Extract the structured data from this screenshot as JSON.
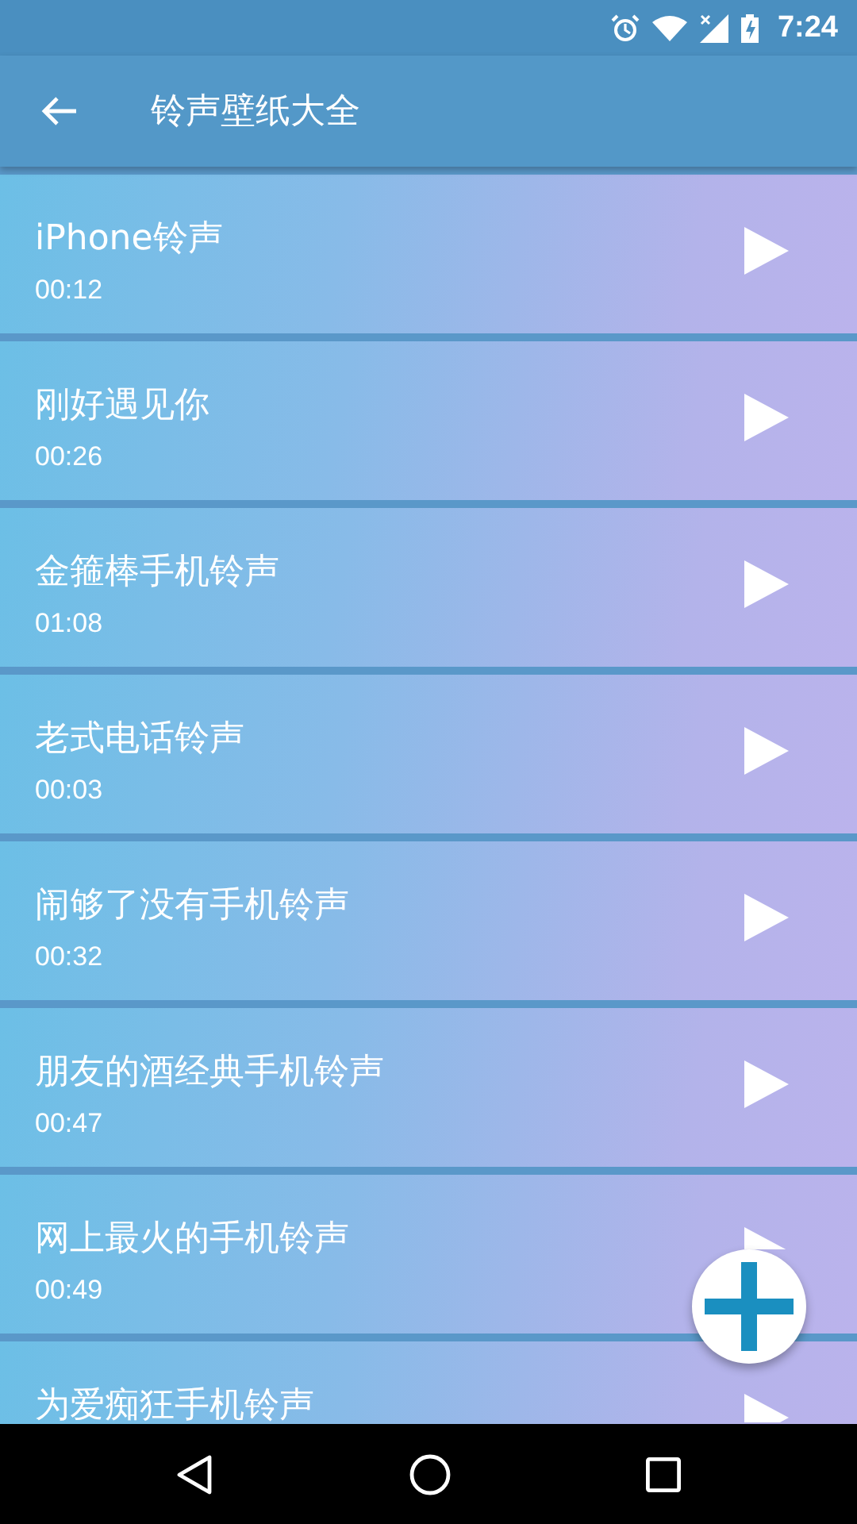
{
  "status_bar": {
    "time": "7:24"
  },
  "toolbar": {
    "title": "铃声壁纸大全"
  },
  "ringtones": [
    {
      "title": "iPhone铃声",
      "duration": "00:12"
    },
    {
      "title": "刚好遇见你",
      "duration": "00:26"
    },
    {
      "title": "金箍棒手机铃声",
      "duration": "01:08"
    },
    {
      "title": "老式电话铃声",
      "duration": "00:03"
    },
    {
      "title": "闹够了没有手机铃声",
      "duration": "00:32"
    },
    {
      "title": "朋友的酒经典手机铃声",
      "duration": "00:47"
    },
    {
      "title": "网上最火的手机铃声",
      "duration": "00:49"
    },
    {
      "title": "为爱痴狂手机铃声"
    }
  ]
}
